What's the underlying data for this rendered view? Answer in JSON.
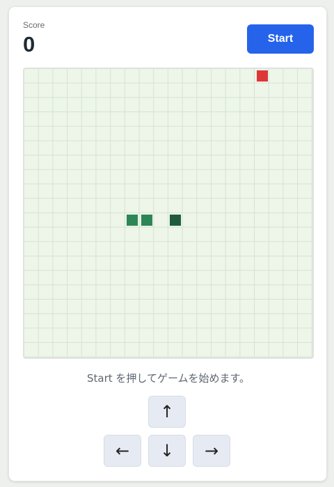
{
  "header": {
    "score_label": "Score",
    "score_value": "0",
    "start_label": "Start"
  },
  "board": {
    "grid_cols": 20,
    "grid_rows": 20,
    "colors": {
      "background": "#edf6e9",
      "grid_line": "#d6e2d2",
      "food": "#dc3838",
      "snake_body": "#2e8657",
      "snake_head": "#1f5c3d"
    },
    "food": {
      "col": 16,
      "row": 0
    },
    "snake": [
      {
        "col": 10,
        "row": 10,
        "head": true
      },
      {
        "col": 8,
        "row": 10,
        "head": false
      },
      {
        "col": 7,
        "row": 10,
        "head": false
      }
    ]
  },
  "status": {
    "message": "Start を押してゲームを始めます。"
  },
  "controls": {
    "up": "↑",
    "left": "←",
    "down": "↓",
    "right": "→"
  }
}
